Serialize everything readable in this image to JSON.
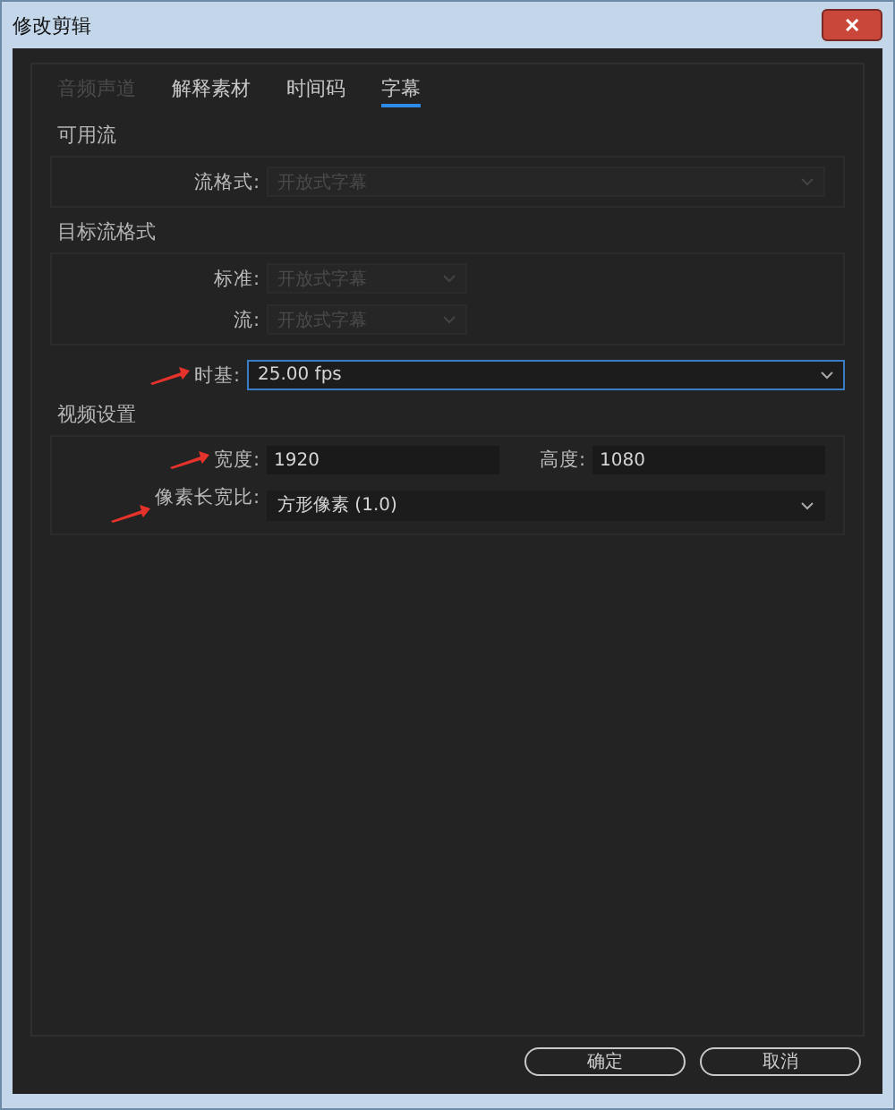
{
  "window": {
    "title": "修改剪辑",
    "close": "✕"
  },
  "tabs": [
    {
      "label": "音频声道",
      "selected": false,
      "disabled": true
    },
    {
      "label": "解释素材",
      "selected": false,
      "disabled": false
    },
    {
      "label": "时间码",
      "selected": false,
      "disabled": false
    },
    {
      "label": "字幕",
      "selected": true,
      "disabled": false
    }
  ],
  "available_stream": {
    "title": "可用流",
    "fields": [
      {
        "label": "流格式:",
        "value": "开放式字幕",
        "disabled": true,
        "wide": true
      }
    ]
  },
  "target_format": {
    "title": "目标流格式",
    "fields": [
      {
        "label": "标准:",
        "value": "开放式字幕",
        "disabled": true,
        "wide": false
      },
      {
        "label": "流:",
        "value": "开放式字幕",
        "disabled": true,
        "wide": false
      }
    ]
  },
  "timebase": {
    "label": "时基:",
    "value": "25.00 fps",
    "focused": true,
    "annotated": true
  },
  "video_settings": {
    "title": "视频设置",
    "width": {
      "label": "宽度:",
      "value": "1920",
      "annotated": true
    },
    "height": {
      "label": "高度:",
      "value": "1080"
    },
    "pixel_aspect": {
      "label": "像素长宽比:",
      "value": "方形像素 (1.0)",
      "annotated": true
    }
  },
  "buttons": [
    {
      "label": "确定"
    },
    {
      "label": "取消"
    }
  ]
}
